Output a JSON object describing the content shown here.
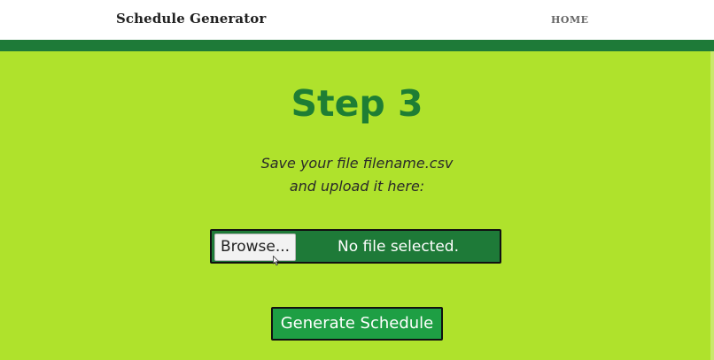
{
  "navbar": {
    "brand": "Schedule Generator",
    "links": [
      {
        "label": "HOME"
      }
    ]
  },
  "main": {
    "title": "Step 3",
    "instructions": [
      "Save your file filename.csv",
      "and upload it here:"
    ],
    "file_input": {
      "browse_label": "Browse...",
      "status": "No file selected."
    },
    "generate_label": "Generate Schedule"
  },
  "colors": {
    "background": "#afe22c",
    "accent_dark": "#1e7a38",
    "title": "#1e7e34",
    "button": "#1e9f44"
  },
  "icons": {
    "cursor": "mouse-pointer-icon"
  }
}
